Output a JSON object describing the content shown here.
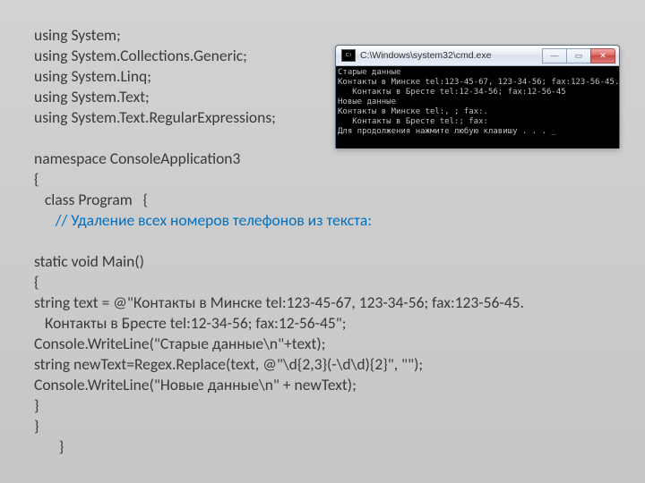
{
  "code": {
    "l1": "using System;",
    "l2": "using System.Collections.Generic;",
    "l3": "using System.Linq;",
    "l4": "using System.Text;",
    "l5": "using System.Text.RegularExpressions;",
    "l6": "",
    "l7": "namespace ConsoleApplication3",
    "l8": "{",
    "l9": "   class Program   {",
    "comment": "      // Удаление всех номеров телефонов из текста:",
    "l10": "",
    "l11": "static void Main()",
    "l12": "{",
    "l13": "string text = @\"Контакты в Минске tel:123-45-67, 123-34-56; fax:123-56-45.",
    "l14": "   Контакты в Бресте tel:12-34-56; fax:12-56-45\";",
    "l15": "Console.WriteLine(\"Старые данные\\n\"+text);",
    "l16": "string newText=Regex.Replace(text, @\"\\d{2,3}(-\\d\\d){2}\", \"\");",
    "l17": "Console.WriteLine(\"Новые данные\\n\" + newText);",
    "l18": "}",
    "l19": "}",
    "l20": "       }"
  },
  "cmd": {
    "title": "C:\\Windows\\system32\\cmd.exe",
    "min": "—",
    "max": "▭",
    "close": "✕",
    "out1": "Старые данные",
    "out2": "Контакты в Минске tel:123-45-67, 123-34-56; fax:123-56-45.",
    "out3": "   Контакты в Бресте tel:12-34-56; fax:12-56-45",
    "out4": "Новые данные",
    "out5": "Контакты в Минске tel:, ; fax:.",
    "out6": "   Контакты в Бресте tel:; fax:",
    "out7": "Для продолжения нажмите любую клавишу . . . _"
  }
}
